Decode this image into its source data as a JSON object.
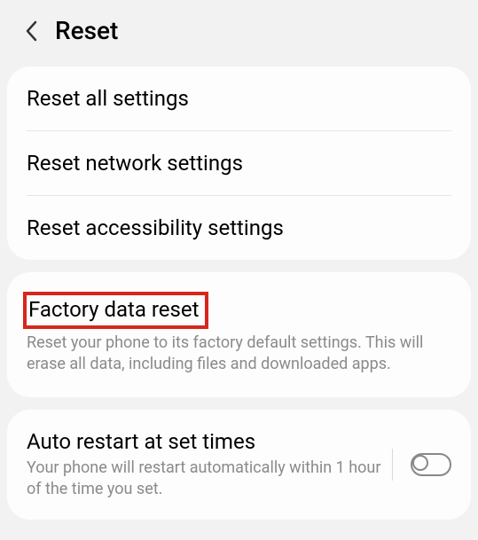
{
  "header": {
    "title": "Reset"
  },
  "group1": {
    "reset_all": "Reset all settings",
    "reset_network": "Reset network settings",
    "reset_accessibility": "Reset accessibility settings"
  },
  "group2": {
    "factory_title": "Factory data reset",
    "factory_desc": "Reset your phone to its factory default settings. This will erase all data, including files and downloaded apps."
  },
  "group3": {
    "auto_restart_title": "Auto restart at set times",
    "auto_restart_desc": "Your phone will restart automatically within 1 hour of the time you set.",
    "auto_restart_on": false
  }
}
